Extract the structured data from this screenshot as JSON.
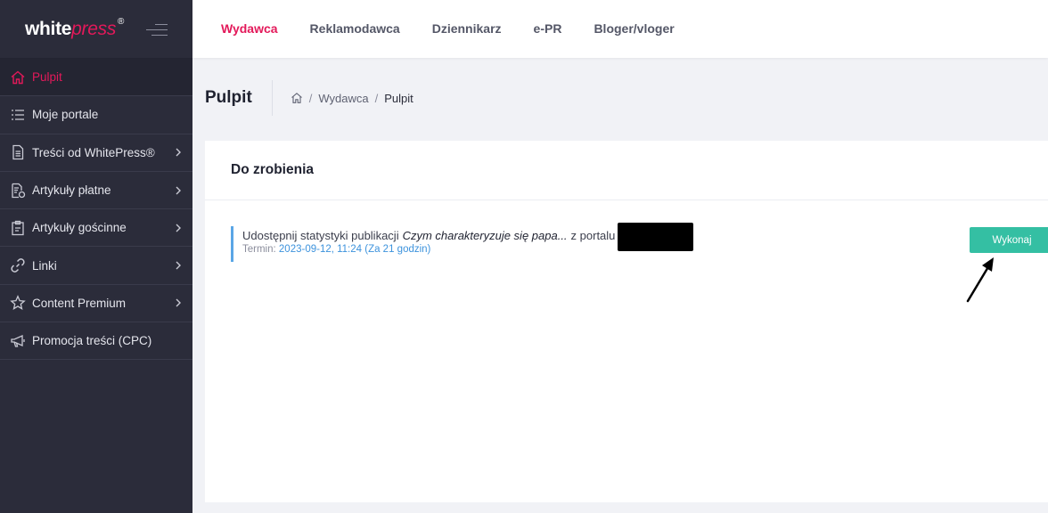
{
  "brand": {
    "logo_white": "white",
    "logo_accent": "press",
    "logo_reg": "®"
  },
  "sidebar": {
    "items": [
      {
        "label": "Pulpit",
        "icon": "home-icon",
        "active": true,
        "chevron": false
      },
      {
        "label": "Moje portale",
        "icon": "list-icon",
        "active": false,
        "chevron": false
      },
      {
        "label": "Treści od WhitePress®",
        "icon": "document-icon",
        "active": false,
        "chevron": true
      },
      {
        "label": "Artykuły płatne",
        "icon": "paid-document-icon",
        "active": false,
        "chevron": true
      },
      {
        "label": "Artykuły gościnne",
        "icon": "clipboard-icon",
        "active": false,
        "chevron": true
      },
      {
        "label": "Linki",
        "icon": "link-icon",
        "active": false,
        "chevron": true
      },
      {
        "label": "Content Premium",
        "icon": "star-icon",
        "active": false,
        "chevron": true
      },
      {
        "label": "Promocja treści (CPC)",
        "icon": "megaphone-icon",
        "active": false,
        "chevron": false
      }
    ]
  },
  "topbar": {
    "tabs": [
      {
        "label": "Wydawca",
        "active": true
      },
      {
        "label": "Reklamodawca",
        "active": false
      },
      {
        "label": "Dziennikarz",
        "active": false
      },
      {
        "label": "e-PR",
        "active": false
      },
      {
        "label": "Bloger/vloger",
        "active": false
      }
    ]
  },
  "page": {
    "title": "Pulpit",
    "breadcrumb": {
      "sep": "/",
      "level1": "Wydawca",
      "level2": "Pulpit"
    }
  },
  "card": {
    "title": "Do zrobienia",
    "task": {
      "prefix": "Udostępnij statystyki publikacji",
      "publication": "Czym charakteryzuje się papa...",
      "suffix": "z portalu",
      "due_label": "Termin:",
      "due_value": "2023-09-12, 11:24 (Za 21 godzin)",
      "button_label": "Wykonaj"
    }
  },
  "colors": {
    "accent": "#e3195a",
    "sidebar_bg": "#2b2c3a",
    "success": "#34bfa3",
    "info": "#5aa6e6"
  }
}
